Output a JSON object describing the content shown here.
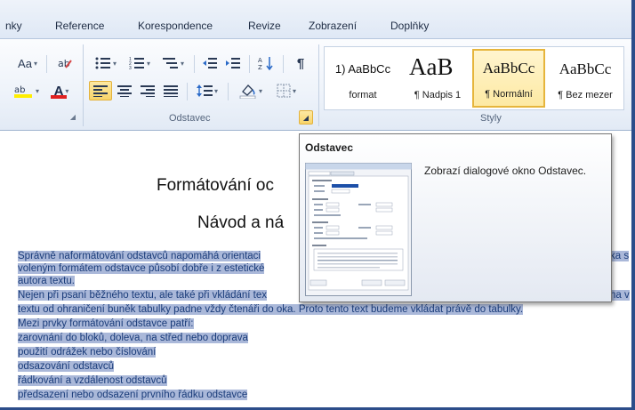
{
  "tabs": [
    "nky",
    "Reference",
    "Korespondence",
    "Revize",
    "Zobrazení",
    "Doplňky"
  ],
  "ribbon": {
    "font_size_btn": "Aa",
    "show_marks_btn": "¶",
    "font_color_btn": "A",
    "paragraph_group_label": "Odstavec",
    "styles_group_label": "Styly"
  },
  "styles": [
    {
      "preview": "1) AaBbCc",
      "name": "format"
    },
    {
      "preview": "AaB",
      "name": "¶ Nadpis 1"
    },
    {
      "preview": "AaBbCc",
      "name": "¶ Normální",
      "selected": true
    },
    {
      "preview": "AaBbCc",
      "name": "¶ Bez mezer"
    }
  ],
  "document": {
    "title1": "Formátování oc",
    "title2": "Návod a ná",
    "lines": [
      "Správně naformátování odstavců napomáhá orientaci",
      "voleným formátem odstavce působí dobře i z estetické",
      "autora textu.",
      "Nejen při psaní běžného textu, ale také při vkládání tex",
      "textu  od ohraničení buněk tabulky padne vždy čtenáři do oka. Proto tento text budeme vkládat právě do tabulky.",
      "Mezi  prvky formátování odstavce patří:",
      "zarovnání do bloků, doleva, na střed nebo doprava",
      "použití odrážek nebo číslování",
      "odsazování odstavců",
      "řádkování a vzdálenost odstavců",
      "předsazení nebo odsazení prvního řádku odstavce"
    ],
    "line_tails": [
      "ka s",
      "",
      "",
      "na v",
      "",
      "",
      "",
      "",
      "",
      "",
      ""
    ]
  },
  "tooltip": {
    "title": "Odstavec",
    "description": "Zobrazí dialogové okno Odstavec."
  },
  "colors": {
    "selection": "#aab8d9",
    "accent_gold": "#f8d46a",
    "frame": "#2c4d8a"
  }
}
